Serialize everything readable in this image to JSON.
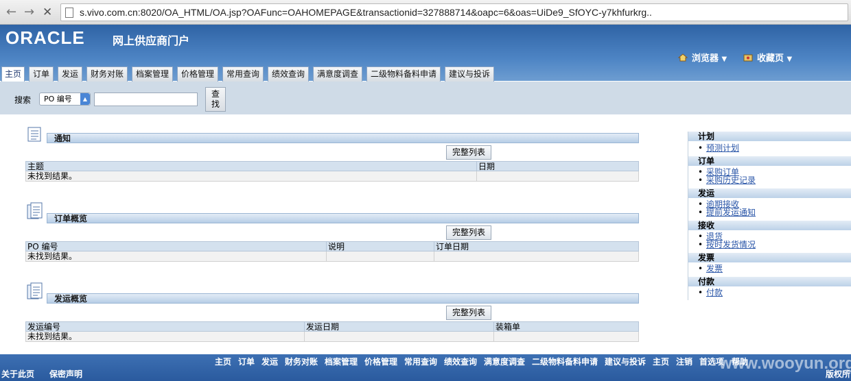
{
  "browser": {
    "back_icon": "back-arrow-icon",
    "forward_icon": "forward-arrow-icon",
    "stop_icon": "stop-icon",
    "url": "s.vivo.com.cn:8020/OA_HTML/OA.jsp?OAFunc=OAHOMEPAGE&transactionid=327888714&oapc=6&oas=UiDe9_SfOYC-y7khfurkrg.."
  },
  "header": {
    "logo": "ORACLE",
    "title": "网上供应商门户",
    "global_links": [
      {
        "label": "浏览器",
        "icon": "home-icon"
      },
      {
        "label": "收藏页",
        "icon": "favorites-icon"
      }
    ],
    "accent_color": "#3a6fb0"
  },
  "tabs": [
    "主页",
    "订单",
    "发运",
    "财务对账",
    "档案管理",
    "价格管理",
    "常用查询",
    "绩效查询",
    "满意度调查",
    "二级物料备料申请",
    "建议与投诉"
  ],
  "search": {
    "label": "搜索",
    "selected_option": "PO 编号",
    "input_value": "",
    "button_label": "查找"
  },
  "sections": [
    {
      "title": "通知",
      "button": "完整列表",
      "columns": [
        "主题",
        "日期"
      ],
      "empty_text": "未找到结果。"
    },
    {
      "title": "订单概览",
      "button": "完整列表",
      "columns": [
        "PO 编号",
        "说明",
        "订单日期"
      ],
      "empty_text": "未找到结果。"
    },
    {
      "title": "发运概览",
      "button": "完整列表",
      "columns": [
        "发运编号",
        "发运日期",
        "装箱单"
      ],
      "empty_text": "未找到结果。"
    }
  ],
  "sidebar": [
    {
      "title": "计划",
      "links": [
        "预测计划"
      ]
    },
    {
      "title": "订单",
      "links": [
        "采购订单",
        "采购历史记录"
      ]
    },
    {
      "title": "发运",
      "links": [
        "逾期接收",
        "提前发运通知"
      ]
    },
    {
      "title": "接收",
      "links": [
        "退货",
        "按时发货情况"
      ]
    },
    {
      "title": "发票",
      "links": [
        "发票"
      ]
    },
    {
      "title": "付款",
      "links": [
        "付款"
      ]
    }
  ],
  "footer": {
    "links": [
      "主页",
      "订单",
      "发运",
      "财务对账",
      "档案管理",
      "价格管理",
      "常用查询",
      "绩效查询",
      "满意度调查",
      "二级物料备料申请",
      "建议与投诉",
      "主页",
      "注销",
      "首选项",
      "帮助"
    ],
    "about": "关于此页",
    "privacy": "保密声明",
    "copyright": "版权所",
    "watermark": "www.wooyun.org"
  }
}
